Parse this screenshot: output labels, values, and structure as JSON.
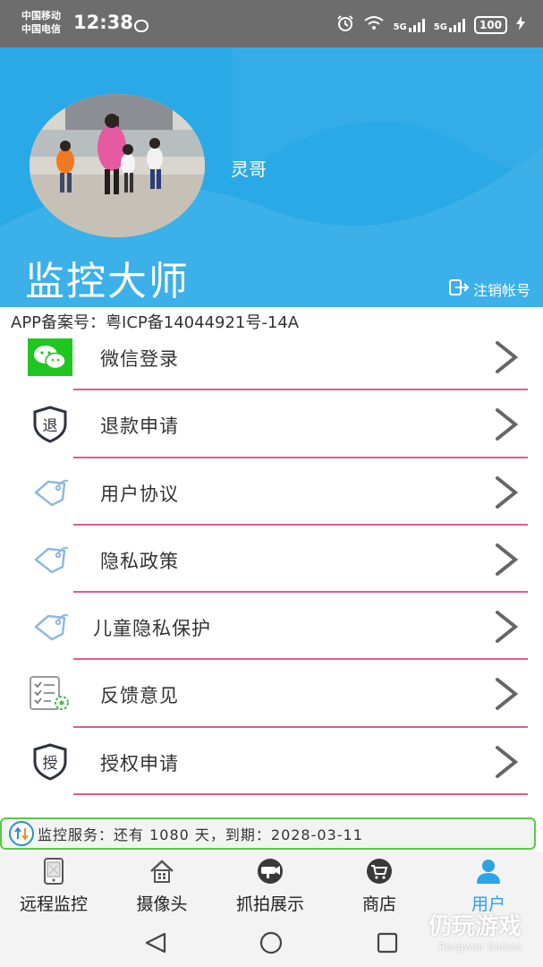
{
  "status_bar": {
    "carrier_1": "中国移动",
    "carrier_2": "中国电信",
    "time": "12:38",
    "signal_1": "5G",
    "signal_2": "5G",
    "battery": "100"
  },
  "header": {
    "username": "灵哥",
    "app_title": "监控大师",
    "logout_label": "注销帐号",
    "background_color": "#29a9e6"
  },
  "icp_text": "APP备案号：粤ICP备14044921号-14A",
  "menu": {
    "items": [
      {
        "label": "微信登录",
        "icon": "wechat-icon"
      },
      {
        "label": "退款申请",
        "icon": "refund-icon"
      },
      {
        "label": "用户协议",
        "icon": "tag-icon"
      },
      {
        "label": "隐私政策",
        "icon": "tag-icon"
      },
      {
        "label": "儿童隐私保护",
        "icon": "tag-icon"
      },
      {
        "label": "反馈意见",
        "icon": "feedback-icon"
      },
      {
        "label": "授权申请",
        "icon": "authorize-icon"
      }
    ],
    "divider_color": "#e05a93"
  },
  "service": {
    "text": "监控服务：还有 1080 天，到期：2028-03-11"
  },
  "tabs": {
    "items": [
      {
        "label": "远程监控",
        "icon": "phone-monitor-icon"
      },
      {
        "label": "摄像头",
        "icon": "home-icon"
      },
      {
        "label": "抓拍展示",
        "icon": "camera-icon"
      },
      {
        "label": "商店",
        "icon": "cart-icon"
      },
      {
        "label": "用户",
        "icon": "user-icon"
      }
    ],
    "active_index": 4,
    "active_color": "#2aa3e8"
  },
  "watermark": {
    "text": "仍玩游戏",
    "sub": "Rengwan Games"
  }
}
